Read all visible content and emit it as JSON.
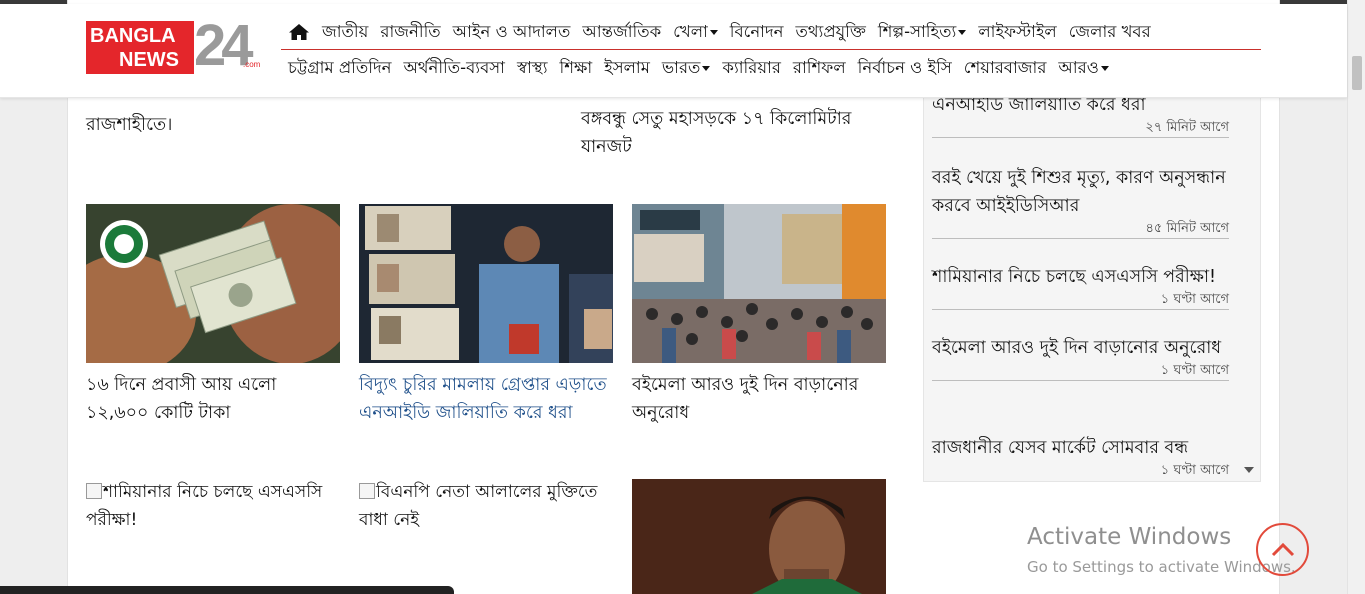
{
  "brand": {
    "line1": "BANGLA",
    "line2": "NEWS",
    "number": "24",
    "suffix": ".com",
    "colors": {
      "red": "#e4262b",
      "grey": "#9a9a9a",
      "link_blue": "#1d4e89"
    }
  },
  "nav": {
    "home_icon": "home-icon",
    "row1": [
      {
        "label": "জাতীয়",
        "dropdown": false
      },
      {
        "label": "রাজনীতি",
        "dropdown": false
      },
      {
        "label": "আইন ও আদালত",
        "dropdown": false
      },
      {
        "label": "আন্তর্জাতিক",
        "dropdown": false
      },
      {
        "label": "খেলা",
        "dropdown": true
      },
      {
        "label": "বিনোদন",
        "dropdown": false
      },
      {
        "label": "তথ্যপ্রযুক্তি",
        "dropdown": false
      },
      {
        "label": "শিল্প-সাহিত্য",
        "dropdown": true
      },
      {
        "label": "লাইফস্টাইল",
        "dropdown": false
      },
      {
        "label": "জেলার খবর",
        "dropdown": false
      }
    ],
    "row2": [
      {
        "label": "চট্টগ্রাম প্রতিদিন",
        "dropdown": false
      },
      {
        "label": "অর্থনীতি-ব্যবসা",
        "dropdown": false
      },
      {
        "label": "স্বাস্থ্য",
        "dropdown": false
      },
      {
        "label": "শিক্ষা",
        "dropdown": false
      },
      {
        "label": "ইসলাম",
        "dropdown": false
      },
      {
        "label": "ভারত",
        "dropdown": true
      },
      {
        "label": "ক্যারিয়ার",
        "dropdown": false
      },
      {
        "label": "রাশিফল",
        "dropdown": false
      },
      {
        "label": "নির্বাচন ও ইসি",
        "dropdown": false
      },
      {
        "label": "শেয়ারবাজার",
        "dropdown": false
      },
      {
        "label": "আরও",
        "dropdown": true
      }
    ]
  },
  "main": {
    "partial_top_left": "রাজশাহীতে।",
    "partial_top_right": "বঙ্গবন্ধু সেতু মহাসড়কে ১৭ কিলোমিটার যানজট",
    "cards": [
      {
        "title": "১৬ দিনে প্রবাসী আয় এলো ১২,৬০০ কোটি টাকা",
        "image": "dollar-notes-photo",
        "highlight": false
      },
      {
        "title": "বিদ্যুৎ চুরির মামলায় গ্রেপ্তার এড়াতে এনআইডি জালিয়াতি করে ধরা",
        "image": "nid-cards-man-photo",
        "highlight": true
      },
      {
        "title": "বইমেলা আরও দুই দিন বাড়ানোর অনুরোধ",
        "image": "book-fair-crowd-photo",
        "highlight": false
      }
    ],
    "cards_row2": [
      {
        "title": "শামিয়ানার নিচে চলছে এসএসসি পরীক্ষা!",
        "image": "broken-image-icon"
      },
      {
        "title": "বিএনপি নেতা আলালের মুক্তিতে বাধা নেই",
        "image": "broken-image-icon"
      },
      {
        "title": "",
        "image": "athlete-photo"
      }
    ]
  },
  "sidebar": {
    "items": [
      {
        "title": "এনআইডি জালিয়াতি করে ধরা",
        "time": "২৭ মিনিট আগে"
      },
      {
        "title": "বরই খেয়ে দুই শিশুর মৃত্যু, কারণ অনুসন্ধান করবে আইইডিসিআর",
        "time": "৪৫ মিনিট আগে"
      },
      {
        "title": "শামিয়ানার নিচে চলছে এসএসসি পরীক্ষা!",
        "time": "১ ঘণ্টা আগে"
      },
      {
        "title": "বইমেলা আরও দুই দিন বাড়ানোর অনুরোধ",
        "time": "১ ঘণ্টা আগে"
      },
      {
        "title": "রাজধানীর যেসব মার্কেট সোমবার বন্ধ",
        "time": "১ ঘণ্টা আগে"
      }
    ]
  },
  "windows": {
    "title": "Activate Windows",
    "subtitle": "Go to Settings to activate Windows."
  },
  "ui": {
    "scroll_up_icon": "chevron-up-icon"
  }
}
